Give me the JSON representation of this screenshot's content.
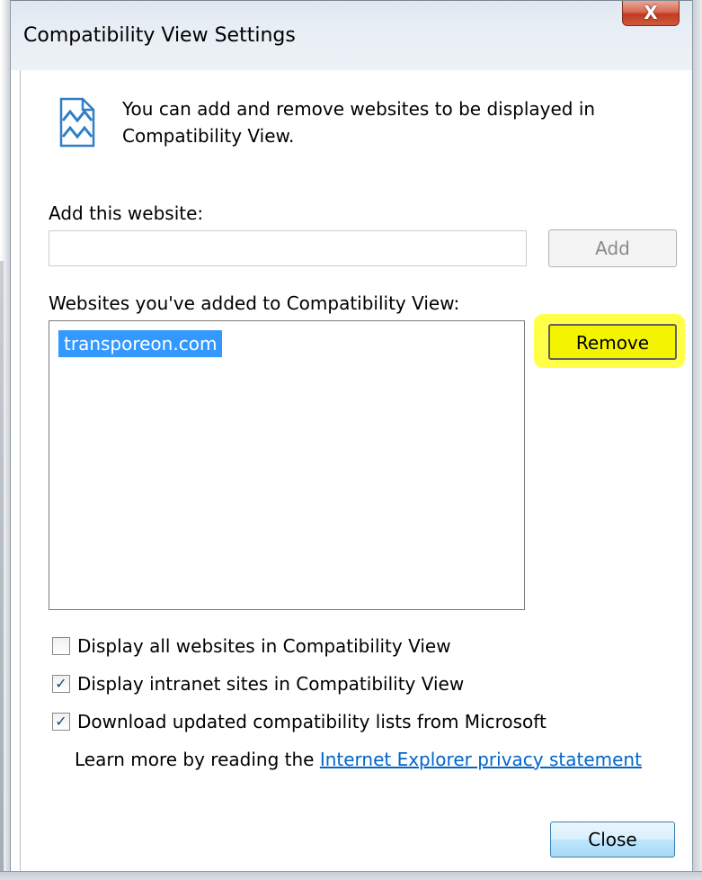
{
  "window": {
    "title": "Compatibility View Settings",
    "close_glyph": "X"
  },
  "info": {
    "icon": "compatibility-view-icon",
    "text": "You can add and remove websites to be displayed in Compatibility View."
  },
  "add_section": {
    "label": "Add this website:",
    "input_value": "",
    "add_button": "Add"
  },
  "list_section": {
    "label": "Websites you've added to Compatibility View:",
    "items": [
      "transporeon.com"
    ],
    "remove_button": "Remove"
  },
  "options": [
    {
      "label": "Display all websites in Compatibility View",
      "checked": false
    },
    {
      "label": "Display intranet sites in Compatibility View",
      "checked": true
    },
    {
      "label": "Download updated compatibility lists from Microsoft",
      "checked": true
    }
  ],
  "learn_more": {
    "prefix": "Learn more by reading the ",
    "link_text": "Internet Explorer privacy statement"
  },
  "footer": {
    "close_button": "Close"
  },
  "colors": {
    "selection": "#3399ff",
    "highlight": "#ffff33",
    "link": "#0066cc"
  }
}
